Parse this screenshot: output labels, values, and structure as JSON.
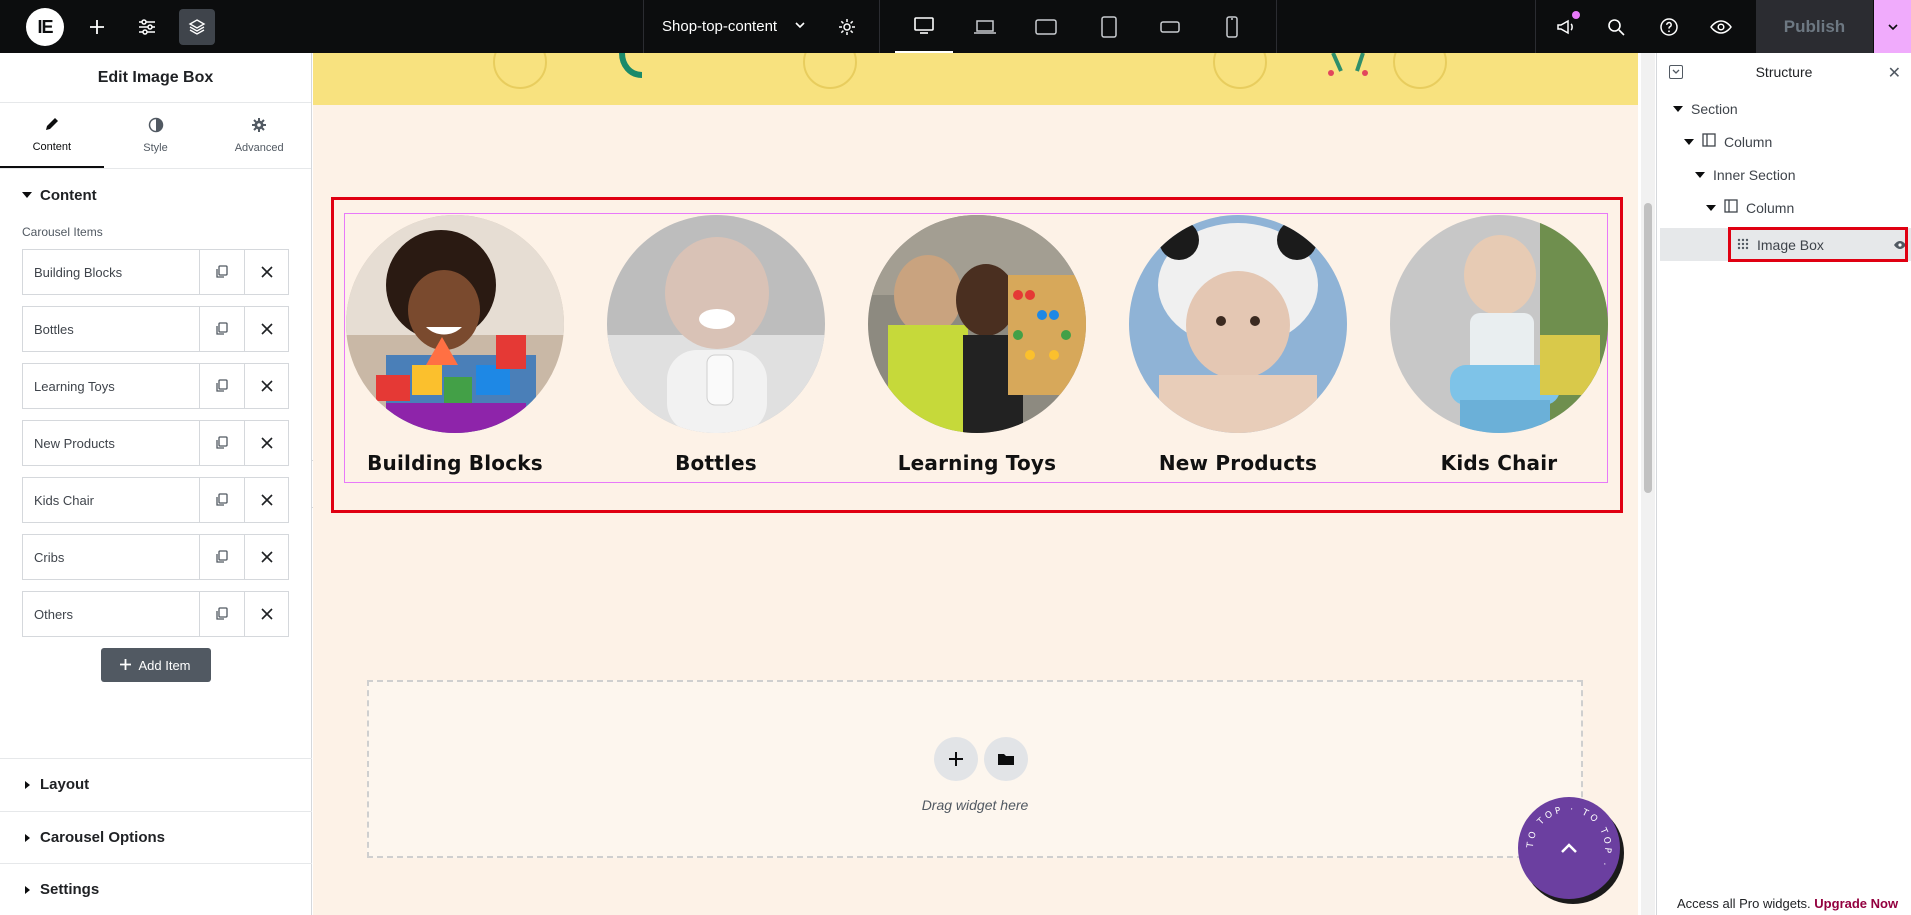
{
  "topbar": {
    "logo_text": "IE",
    "document_title": "Shop-top-content",
    "publish_label": "Publish",
    "devices": [
      "desktop-icon",
      "laptop-icon",
      "tablet-landscape-icon",
      "tablet-portrait-icon",
      "mobile-landscape-icon",
      "mobile-portrait-icon"
    ],
    "accent_pink": "#f0abfc"
  },
  "panel": {
    "title": "Edit Image Box",
    "tabs": [
      {
        "label": "Content",
        "icon": "pencil-icon"
      },
      {
        "label": "Style",
        "icon": "half-circle-icon"
      },
      {
        "label": "Advanced",
        "icon": "gear-icon"
      }
    ],
    "content_section": "Content",
    "repeater_label": "Carousel Items",
    "items": [
      "Building Blocks",
      "Bottles",
      "Learning Toys",
      "New Products",
      "Kids Chair",
      "Cribs",
      "Others"
    ],
    "add_item": "Add Item",
    "sections": [
      "Layout",
      "Carousel Options",
      "Settings"
    ]
  },
  "canvas": {
    "slides": [
      "Building Blocks",
      "Bottles",
      "Learning Toys",
      "New Products",
      "Kids Chair"
    ],
    "drop_label": "Drag widget here",
    "totop_text": "TO TOP · TO TOP ·",
    "background": "#fdf2e7",
    "banner_color": "#f8e27f"
  },
  "structure": {
    "title": "Structure",
    "nodes": [
      "Section",
      "Column",
      "Inner Section",
      "Column",
      "Image Box"
    ],
    "pro_text": "Access all Pro widgets.",
    "upgrade_text": "Upgrade Now"
  }
}
